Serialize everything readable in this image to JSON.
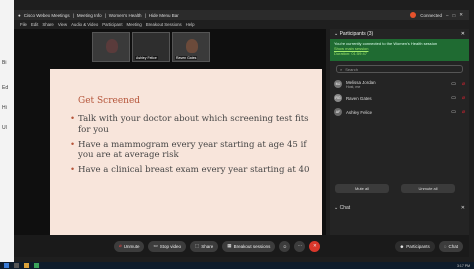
{
  "window": {
    "tabs": [
      "Cisco Webex Meetings",
      "Meeting Info",
      "Women's Health",
      "Hide Menu Bar"
    ],
    "status": "Connected"
  },
  "menu": [
    "File",
    "Edit",
    "Share",
    "View",
    "Audio & Video",
    "Participant",
    "Meeting",
    "Breakout Sessions",
    "Help"
  ],
  "videos": [
    {
      "name": "",
      "color": "#5a3b3b"
    },
    {
      "name": "Ashley Felice",
      "color": "#444444"
    },
    {
      "name": "Raven Gates",
      "color": "#6b4a3a"
    }
  ],
  "slide": {
    "title": "Get Screened",
    "bullets": [
      "Talk with your doctor about which screening test fits for you",
      "Have a mammogram every year starting at age 45 if you are at average risk",
      "Have a clinical breast exam every year starting at 40"
    ]
  },
  "participants": {
    "header": "Participants (3)",
    "notice": "You're currently connected to the Women's Health session",
    "notice_link": "Show main session",
    "duration": "Duration: 01:59:47",
    "search_placeholder": "Search",
    "list": [
      {
        "initials": "MJ",
        "name": "Melissa Jordan",
        "sub": "Host, me",
        "color": "#777777"
      },
      {
        "initials": "RG",
        "name": "Raven Gates",
        "sub": "",
        "color": "#888888"
      },
      {
        "initials": "AF",
        "name": "Ashley Felice",
        "sub": "",
        "color": "#6a6a6a"
      }
    ],
    "mute_all": "Mute all",
    "unmute_all": "Unmute all"
  },
  "chat": {
    "header": "Chat",
    "to": "To: Everyone in this breakout session",
    "placeholder": "Enter chat message here"
  },
  "toolbar": {
    "unmute": "Unmute",
    "stop_video": "Stop video",
    "share": "Share",
    "breakout": "Breakout sessions",
    "participants": "Participants",
    "chat": "Chat"
  },
  "taskbar": {
    "clock": "3:17 PM"
  }
}
